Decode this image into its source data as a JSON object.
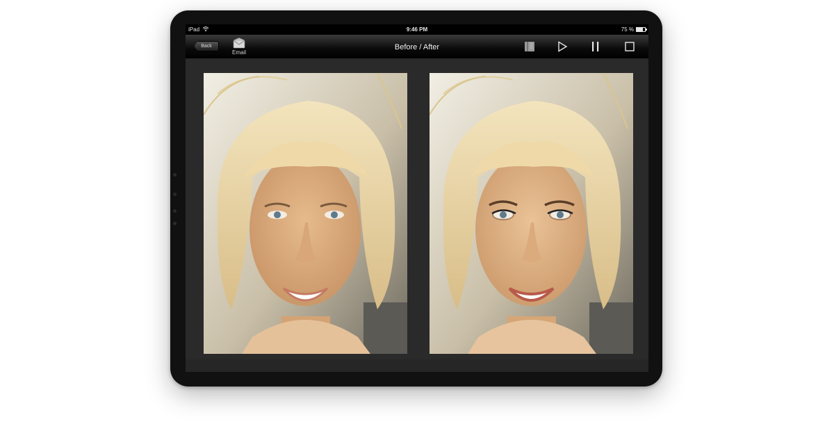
{
  "status_bar": {
    "device": "iPad",
    "time": "9:46 PM",
    "battery": "75 %",
    "battery_level": 0.75
  },
  "toolbar": {
    "back_label": "Back",
    "email_label": "Email",
    "title": "Before / After",
    "icons": [
      "book-icon",
      "play-icon",
      "pause-icon",
      "stop-icon"
    ]
  },
  "photos": {
    "before": "before-photo",
    "after": "after-photo"
  },
  "colors": {
    "screen_bg": "#2a2a2a",
    "bar_bg": "#000000",
    "hair": "#e8d3a0",
    "skin": "#dcae7e"
  }
}
